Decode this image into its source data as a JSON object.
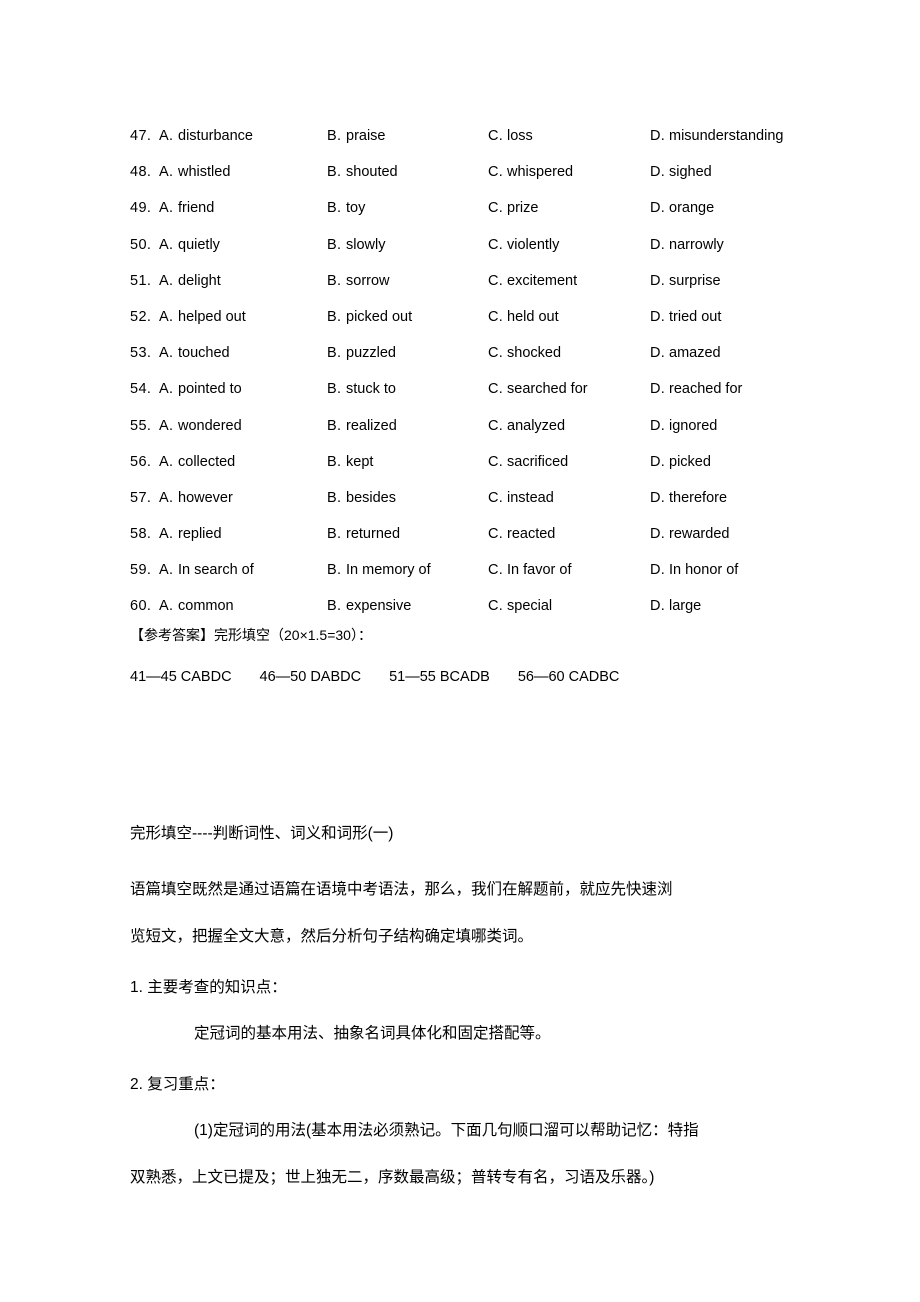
{
  "document": {
    "cloze_options": {
      "column_labels": [
        "A.",
        "B.",
        "C.",
        "D."
      ],
      "rows": [
        {
          "number": "47.",
          "a": "disturbance",
          "b": "praise",
          "c": "loss",
          "d": "misunderstanding"
        },
        {
          "number": "48.",
          "a": "whistled",
          "b": "shouted",
          "c": "whispered",
          "d": "sighed"
        },
        {
          "number": "49.",
          "a": "friend",
          "b": "toy",
          "c": "prize",
          "d": "orange"
        },
        {
          "number": "50.",
          "a": "quietly",
          "b": "slowly",
          "c": "violently",
          "d": "narrowly"
        },
        {
          "number": "51.",
          "a": "delight",
          "b": "sorrow",
          "c": "excitement",
          "d": "surprise"
        },
        {
          "number": "52.",
          "a": "helped out",
          "b": "picked out",
          "c": "held out",
          "d": "tried out"
        },
        {
          "number": "53.",
          "a": "touched",
          "b": "puzzled",
          "c": "shocked",
          "d": "amazed"
        },
        {
          "number": "54.",
          "a": "pointed to",
          "b": "stuck to",
          "c": "searched for",
          "d": "reached for"
        },
        {
          "number": "55.",
          "a": "wondered",
          "b": "realized",
          "c": "analyzed",
          "d": "ignored"
        },
        {
          "number": "56.",
          "a": "collected",
          "b": "kept",
          "c": "sacrificed",
          "d": "picked"
        },
        {
          "number": "57.",
          "a": "however",
          "b": "besides",
          "c": "instead",
          "d": "therefore"
        },
        {
          "number": "58.",
          "a": "replied",
          "b": "returned",
          "c": "reacted",
          "d": "rewarded"
        },
        {
          "number": "59.",
          "a": "In search of",
          "b": "In memory of",
          "c": "In favor of",
          "d": "In honor of"
        },
        {
          "number": "60.",
          "a": "common",
          "b": "expensive",
          "c": "special",
          "d": "large"
        }
      ]
    },
    "answer_key": {
      "heading": "【参考答案】完形填空（20×1.5=30）：",
      "groups": [
        "41—45 CABDC",
        "46—50 DABDC",
        "51—55 BCADB",
        "56—60 CADBC"
      ]
    },
    "lesson": {
      "title": "完形填空----判断词性、词义和词形(一)",
      "intro_line_1": "语篇填空既然是通过语篇在语境中考语法，那么，我们在解题前，就应先快速浏",
      "intro_line_2": "览短文，把握全文大意，然后分析句子结构确定填哪类词。",
      "item_1": "1. 主要考查的知识点：",
      "item_1_detail": "定冠词的基本用法、抽象名词具体化和固定搭配等。",
      "item_2": "2. 复习重点：",
      "item_2_detail_line_1": "(1)定冠词的用法(基本用法必须熟记。下面几句顺口溜可以帮助记忆：特指",
      "item_2_detail_line_2": "双熟悉，上文已提及；世上独无二，序数最高级；普转专有名，习语及乐器。)"
    }
  }
}
